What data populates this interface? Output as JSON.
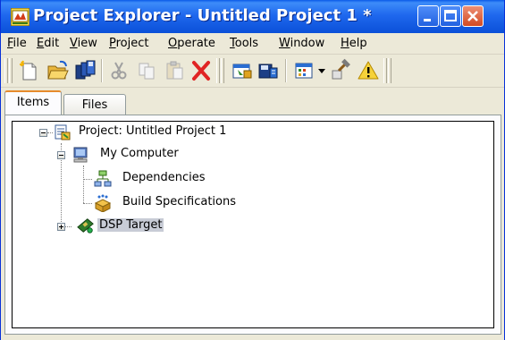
{
  "window": {
    "title": "Project Explorer - Untitled Project 1 *",
    "icon": "labview-project-icon",
    "controls": [
      "minimize",
      "maximize",
      "close"
    ]
  },
  "menu": {
    "items": [
      {
        "label": "File",
        "accelerator": "F"
      },
      {
        "label": "Edit",
        "accelerator": "E"
      },
      {
        "label": "View",
        "accelerator": "V"
      },
      {
        "label": "Project",
        "accelerator": "P"
      },
      {
        "label": "Operate",
        "accelerator": "O"
      },
      {
        "label": "Tools",
        "accelerator": "T"
      },
      {
        "label": "Window",
        "accelerator": "W"
      },
      {
        "label": "Help",
        "accelerator": "H"
      }
    ]
  },
  "toolbar": {
    "buttons": [
      {
        "icon": "new-icon"
      },
      {
        "icon": "open-folder-icon"
      },
      {
        "icon": "save-all-icon"
      },
      {
        "icon": "cut-icon",
        "disabled": true
      },
      {
        "icon": "copy-icon",
        "disabled": true
      },
      {
        "icon": "paste-icon",
        "disabled": true
      },
      {
        "icon": "delete-icon"
      },
      {
        "icon": "add-vi-icon"
      },
      {
        "icon": "build-icon"
      },
      {
        "icon": "view-dropdown-icon"
      },
      {
        "icon": "hammer-icon"
      },
      {
        "icon": "warning-icon"
      }
    ]
  },
  "tabs": [
    {
      "label": "Items",
      "active": true
    },
    {
      "label": "Files",
      "active": false
    }
  ],
  "tree": {
    "nodes": [
      {
        "label": "Project: Untitled Project 1",
        "icon": "project-icon",
        "level": 0,
        "expanded": true
      },
      {
        "label": "My Computer",
        "icon": "computer-icon",
        "level": 1,
        "expanded": true
      },
      {
        "label": "Dependencies",
        "icon": "dependencies-icon",
        "level": 2
      },
      {
        "label": "Build Specifications",
        "icon": "build-specifications-icon",
        "level": 2
      },
      {
        "label": "DSP Target",
        "icon": "dsp-target-icon",
        "level": 1,
        "expanded": false,
        "selected": true
      }
    ]
  },
  "colors": {
    "titlebar": "#1f68ee",
    "chrome": "#ece9d8",
    "active_tab_accent": "#e68b2c",
    "selection": "#c8ccd6"
  }
}
